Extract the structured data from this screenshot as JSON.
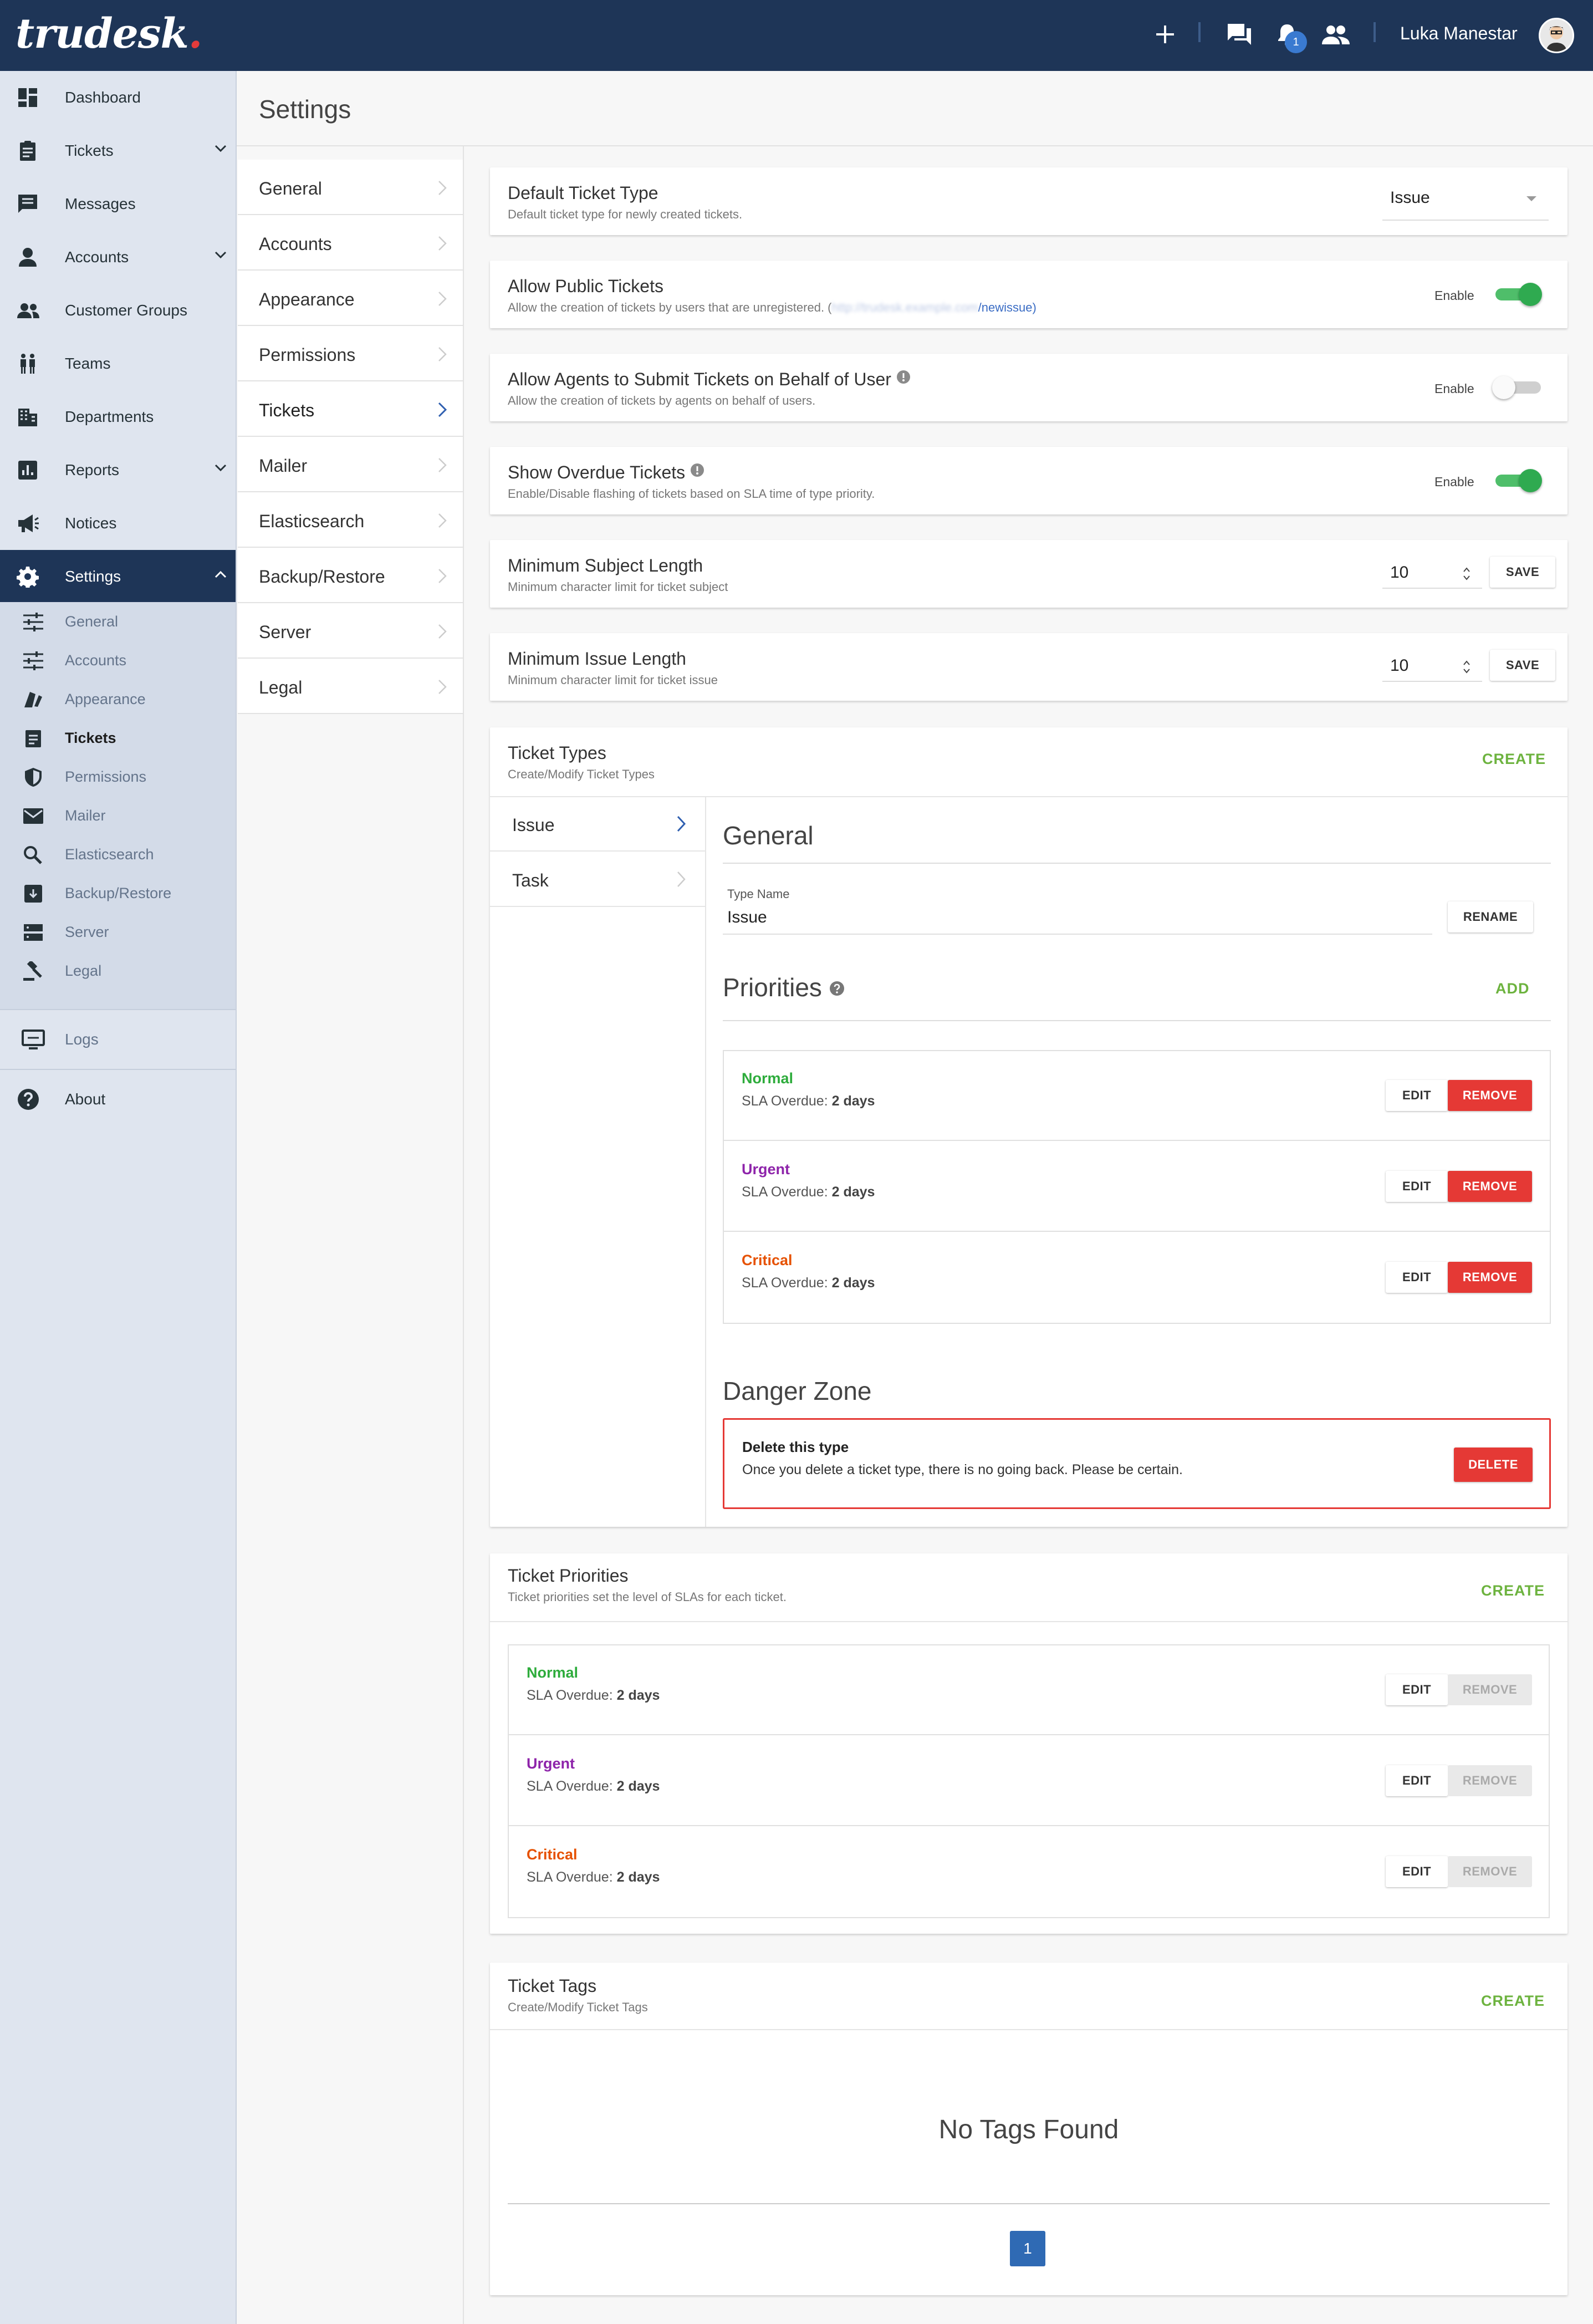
{
  "app": {
    "logo": "trudesk",
    "logo_dot": "."
  },
  "topbar": {
    "username": "Luka Manestar",
    "notification_count": "1",
    "icons": [
      "plus-icon",
      "chat-icon",
      "bell-icon",
      "users-icon"
    ]
  },
  "sidebar": {
    "items": [
      {
        "label": "Dashboard",
        "icon": "dashboard-icon"
      },
      {
        "label": "Tickets",
        "icon": "clipboard-icon",
        "expandable": true
      },
      {
        "label": "Messages",
        "icon": "message-icon"
      },
      {
        "label": "Accounts",
        "icon": "person-icon",
        "expandable": true
      },
      {
        "label": "Customer Groups",
        "icon": "group-icon"
      },
      {
        "label": "Teams",
        "icon": "teams-icon"
      },
      {
        "label": "Departments",
        "icon": "building-icon"
      },
      {
        "label": "Reports",
        "icon": "chart-icon",
        "expandable": true
      },
      {
        "label": "Notices",
        "icon": "megaphone-icon"
      },
      {
        "label": "Settings",
        "icon": "gear-icon",
        "expandable": true,
        "active": true
      }
    ],
    "settings_sub": [
      {
        "label": "General",
        "icon": "tune-icon"
      },
      {
        "label": "Accounts",
        "icon": "tune-icon"
      },
      {
        "label": "Appearance",
        "icon": "palette-icon"
      },
      {
        "label": "Tickets",
        "icon": "clipboard-icon",
        "current": true
      },
      {
        "label": "Permissions",
        "icon": "shield-icon"
      },
      {
        "label": "Mailer",
        "icon": "mail-icon"
      },
      {
        "label": "Elasticsearch",
        "icon": "search-icon"
      },
      {
        "label": "Backup/Restore",
        "icon": "archive-icon"
      },
      {
        "label": "Server",
        "icon": "server-icon"
      },
      {
        "label": "Legal",
        "icon": "gavel-icon"
      }
    ],
    "logs_label": "Logs",
    "about_label": "About"
  },
  "page": {
    "title": "Settings"
  },
  "settings_menu": [
    "General",
    "Accounts",
    "Appearance",
    "Permissions",
    "Tickets",
    "Mailer",
    "Elasticsearch",
    "Backup/Restore",
    "Server",
    "Legal"
  ],
  "default_ticket_type": {
    "title": "Default Ticket Type",
    "subtitle": "Default ticket type for newly created tickets.",
    "value": "Issue"
  },
  "allow_public": {
    "title": "Allow Public Tickets",
    "subtitle_prefix": "Allow the creation of tickets by users that are unregistered. (",
    "subtitle_blurred": "http://trudesk.example.com",
    "subtitle_link": "/newissue",
    "subtitle_suffix": ")",
    "toggle_label": "Enable",
    "enabled": true
  },
  "agents_submit": {
    "title": "Allow Agents to Submit Tickets on Behalf of User",
    "subtitle": "Allow the creation of tickets by agents on behalf of users.",
    "toggle_label": "Enable",
    "enabled": false
  },
  "overdue": {
    "title": "Show Overdue Tickets",
    "subtitle": "Enable/Disable flashing of tickets based on SLA time of type priority.",
    "toggle_label": "Enable",
    "enabled": true
  },
  "min_subject": {
    "title": "Minimum Subject Length",
    "subtitle": "Minimum character limit for ticket subject",
    "value": "10",
    "save_label": "SAVE"
  },
  "min_issue": {
    "title": "Minimum Issue Length",
    "subtitle": "Minimum character limit for ticket issue",
    "value": "10",
    "save_label": "SAVE"
  },
  "ticket_types": {
    "title": "Ticket Types",
    "subtitle": "Create/Modify Ticket Types",
    "create_label": "CREATE",
    "types": [
      "Issue",
      "Task"
    ],
    "general_heading": "General",
    "type_name_label": "Type Name",
    "type_name_value": "Issue",
    "rename_label": "RENAME",
    "priorities_heading": "Priorities",
    "add_label": "ADD",
    "priorities": [
      {
        "name": "Normal",
        "sla_label": "SLA Overdue:",
        "sla_value": "2 days",
        "color": "#2eac3c"
      },
      {
        "name": "Urgent",
        "sla_label": "SLA Overdue:",
        "sla_value": "2 days",
        "color": "#8e24aa"
      },
      {
        "name": "Critical",
        "sla_label": "SLA Overdue:",
        "sla_value": "2 days",
        "color": "#e65100"
      }
    ],
    "edit_label": "EDIT",
    "remove_label": "REMOVE",
    "danger_heading": "Danger Zone",
    "danger_title": "Delete this type",
    "danger_text": "Once you delete a ticket type, there is no going back. Please be certain.",
    "delete_label": "DELETE"
  },
  "ticket_priorities": {
    "title": "Ticket Priorities",
    "subtitle": "Ticket priorities set the level of SLAs for each ticket.",
    "create_label": "CREATE",
    "priorities": [
      {
        "name": "Normal",
        "sla_label": "SLA Overdue:",
        "sla_value": "2 days",
        "color": "#2eac3c"
      },
      {
        "name": "Urgent",
        "sla_label": "SLA Overdue:",
        "sla_value": "2 days",
        "color": "#8e24aa"
      },
      {
        "name": "Critical",
        "sla_label": "SLA Overdue:",
        "sla_value": "2 days",
        "color": "#e65100"
      }
    ],
    "edit_label": "EDIT",
    "remove_label": "REMOVE"
  },
  "ticket_tags": {
    "title": "Ticket Tags",
    "subtitle": "Create/Modify Ticket Tags",
    "create_label": "CREATE",
    "empty_text": "No Tags Found",
    "page": "1"
  }
}
